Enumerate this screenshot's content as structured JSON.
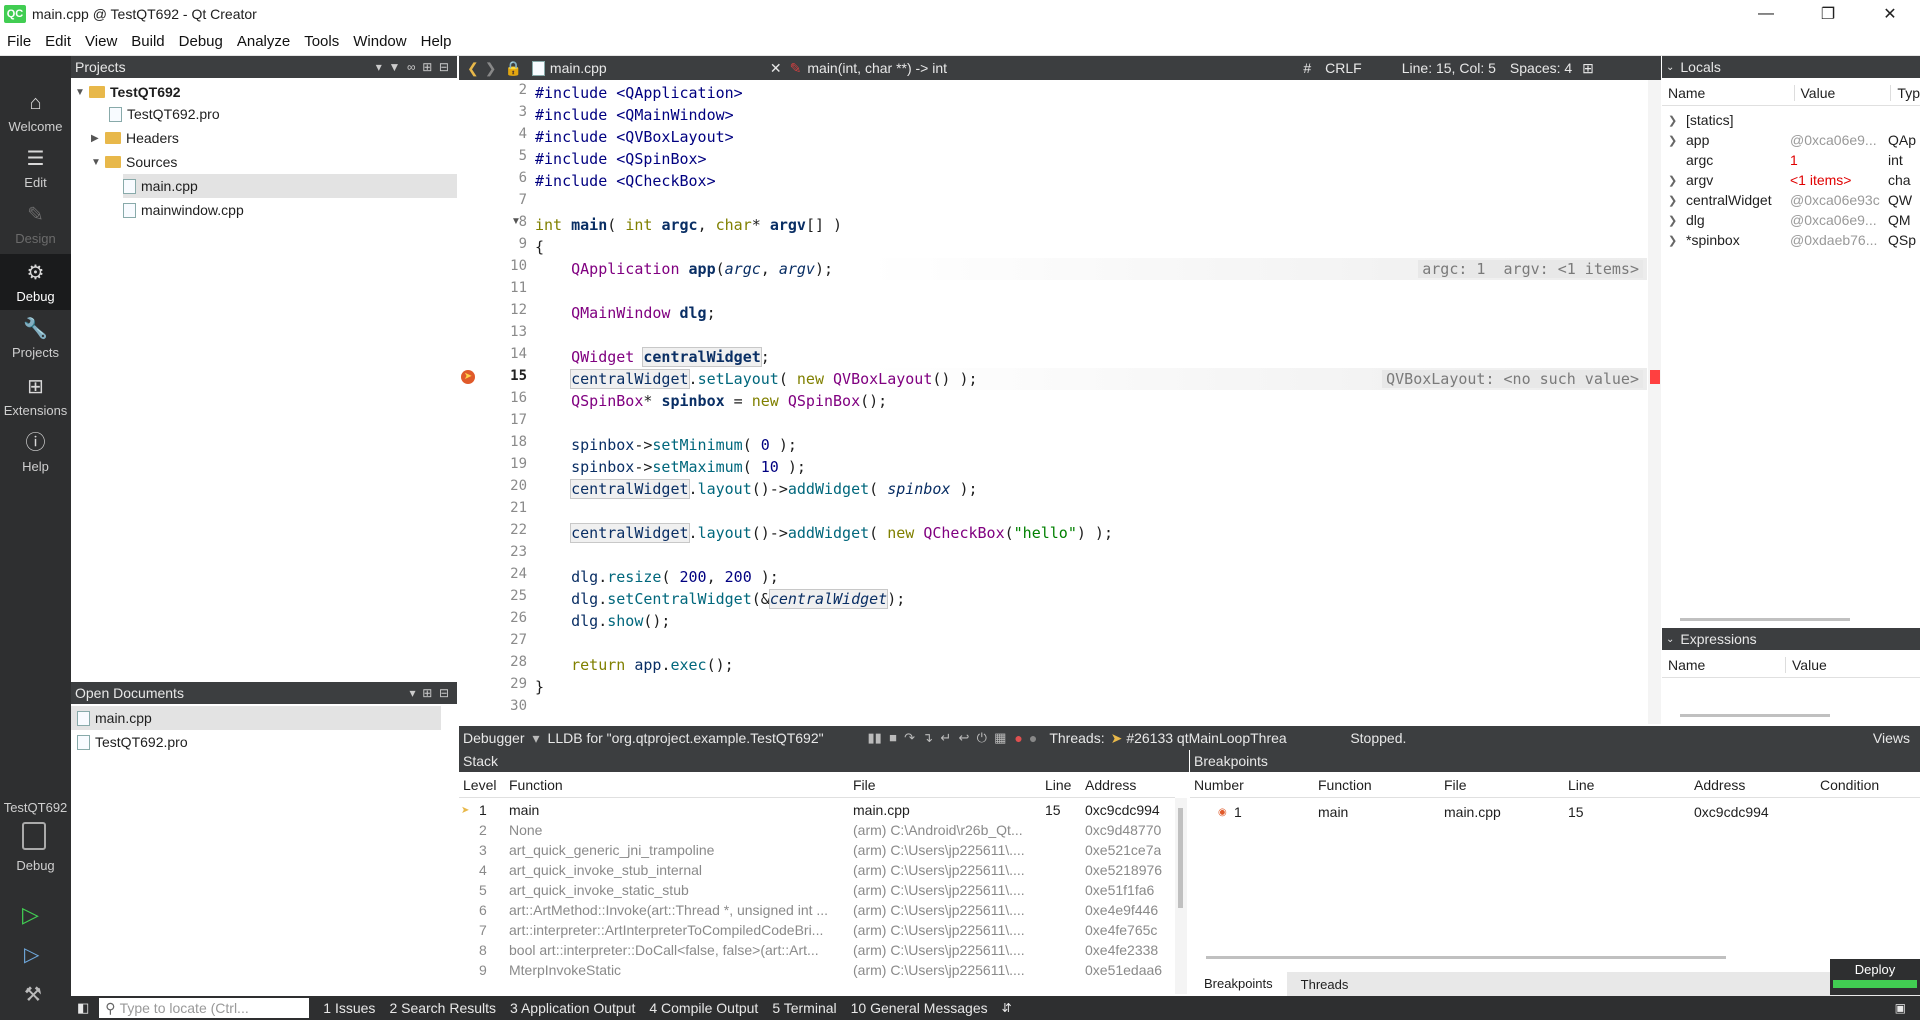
{
  "window": {
    "title": "main.cpp @ TestQT692 - Qt Creator",
    "logo": "QC"
  },
  "menu": [
    "File",
    "Edit",
    "View",
    "Build",
    "Debug",
    "Analyze",
    "Tools",
    "Window",
    "Help"
  ],
  "modes": {
    "welcome": "Welcome",
    "edit": "Edit",
    "design": "Design",
    "debug": "Debug",
    "projects": "Projects",
    "extensions": "Extensions",
    "help": "Help",
    "kit_project": "TestQT692",
    "kit_mode": "Debug"
  },
  "projects": {
    "header": "Projects",
    "items": [
      {
        "label": "TestQT692"
      },
      {
        "label": "TestQT692.pro"
      },
      {
        "label": "Headers"
      },
      {
        "label": "Sources"
      },
      {
        "label": "main.cpp"
      },
      {
        "label": "mainwindow.cpp"
      }
    ]
  },
  "open_documents": {
    "header": "Open Documents",
    "items": [
      "main.cpp",
      "TestQT692.pro"
    ]
  },
  "editor_toolbar": {
    "file": "main.cpp",
    "symbol": "main(int, char **) -> int",
    "hash": "#",
    "eol": "CRLF",
    "position": "Line: 15, Col: 5",
    "spaces": "Spaces: 4"
  },
  "code": {
    "line_numbers": [
      "2",
      "3",
      "4",
      "5",
      "6",
      "7",
      "8",
      "9",
      "10",
      "11",
      "12",
      "13",
      "14",
      "15",
      "16",
      "17",
      "18",
      "19",
      "20",
      "21",
      "22",
      "23",
      "24",
      "25",
      "26",
      "27",
      "28",
      "29",
      "30"
    ],
    "ann_line10": "argc: 1  argv: <1 items>",
    "ann_line15": "QVBoxLayout: <no such value>"
  },
  "locals": {
    "header": "Locals",
    "col_name": "Name",
    "col_value": "Value",
    "col_type": "Typ",
    "rows": [
      {
        "name": "[statics]",
        "value": "",
        "type": ""
      },
      {
        "name": "app",
        "value": "@0xca06e9...",
        "type": "QAp"
      },
      {
        "name": "argc",
        "value": "1",
        "type": "int"
      },
      {
        "name": "argv",
        "value": "<1 items>",
        "type": "cha"
      },
      {
        "name": "centralWidget",
        "value": "@0xca06e93c",
        "type": "QW"
      },
      {
        "name": "dlg",
        "value": "@0xca06e9...",
        "type": "QM"
      },
      {
        "name": "*spinbox",
        "value": "@0xdaeb76...",
        "type": "QSp"
      }
    ]
  },
  "expressions": {
    "header": "Expressions",
    "col_name": "Name",
    "col_value": "Value"
  },
  "debugger": {
    "label": "Debugger",
    "engine": "LLDB for \"org.qtproject.example.TestQT692\"",
    "threads_label": "Threads:",
    "thread": "#26133 qtMainLoopThrea",
    "status": "Stopped.",
    "views": "Views"
  },
  "stack": {
    "header": "Stack",
    "cols": [
      "Level",
      "Function",
      "File",
      "Line",
      "Address"
    ],
    "rows": [
      {
        "level": "1",
        "function": "main",
        "file": "main.cpp",
        "line": "15",
        "address": "0xc9cdc994"
      },
      {
        "level": "2",
        "function": "None",
        "file": "(arm) C:\\Android\\r26b_Qt...",
        "line": "",
        "address": "0xc9d48770"
      },
      {
        "level": "3",
        "function": "art_quick_generic_jni_trampoline",
        "file": "(arm) C:\\Users\\jp225611\\....",
        "line": "",
        "address": "0xe521ce7a"
      },
      {
        "level": "4",
        "function": "art_quick_invoke_stub_internal",
        "file": "(arm) C:\\Users\\jp225611\\....",
        "line": "",
        "address": "0xe5218976"
      },
      {
        "level": "5",
        "function": "art_quick_invoke_static_stub",
        "file": "(arm) C:\\Users\\jp225611\\....",
        "line": "",
        "address": "0xe51f1fa6"
      },
      {
        "level": "6",
        "function": "art::ArtMethod::Invoke(art::Thread *, unsigned int ...",
        "file": "(arm) C:\\Users\\jp225611\\....",
        "line": "",
        "address": "0xe4e9f446"
      },
      {
        "level": "7",
        "function": "art::interpreter::ArtInterpreterToCompiledCodeBri...",
        "file": "(arm) C:\\Users\\jp225611\\....",
        "line": "",
        "address": "0xe4fe765c"
      },
      {
        "level": "8",
        "function": "bool art::interpreter::DoCall<false, false>(art::Art...",
        "file": "(arm) C:\\Users\\jp225611\\....",
        "line": "",
        "address": "0xe4fe2338"
      },
      {
        "level": "9",
        "function": "MterpInvokeStatic",
        "file": "(arm) C:\\Users\\jp225611\\....",
        "line": "",
        "address": "0xe51edaa6"
      }
    ]
  },
  "breakpoints": {
    "header": "Breakpoints",
    "cols": [
      "Number",
      "Function",
      "File",
      "Line",
      "Address",
      "Condition"
    ],
    "rows": [
      {
        "number": "1",
        "function": "main",
        "file": "main.cpp",
        "line": "15",
        "address": "0xc9cdc994",
        "condition": ""
      }
    ],
    "tab_breakpoints": "Breakpoints",
    "tab_threads": "Threads",
    "deploy": "Deploy"
  },
  "statusbar": {
    "locate_placeholder": "Type to locate (Ctrl...",
    "tabs": [
      "1  Issues",
      "2  Search Results",
      "3  Application Output",
      "4  Compile Output",
      "5  Terminal",
      "10 General Messages"
    ]
  }
}
